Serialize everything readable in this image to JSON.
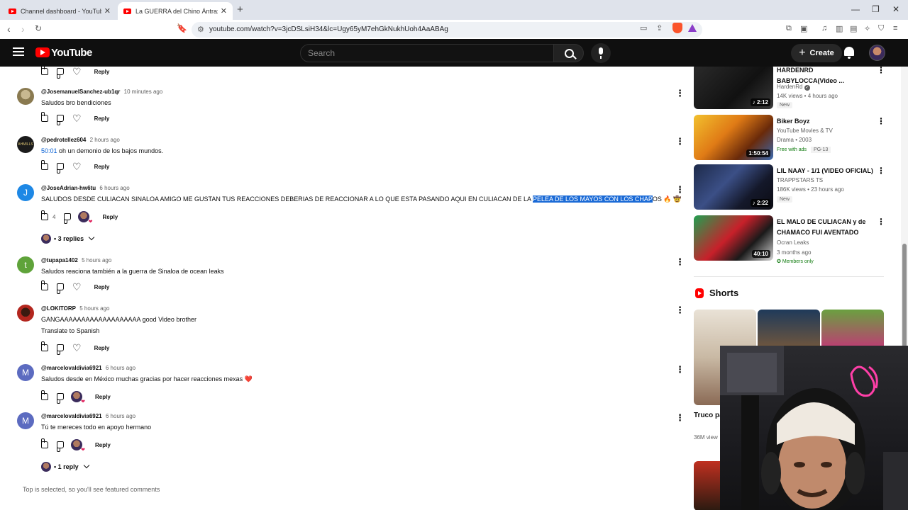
{
  "browser": {
    "tabs": [
      {
        "label": "Channel dashboard - YouTube Studio"
      },
      {
        "label": "La GUERRA del Chino Ántrax vs"
      }
    ],
    "url": "youtube.com/watch?v=3jcDSLsiH34&lc=Ugy65yM7ehGkNukhUoh4AaABAg"
  },
  "masthead": {
    "logo_text": "YouTube",
    "search_placeholder": "Search",
    "create_label": "Create"
  },
  "comments": [
    {
      "handle": "@JosemanuelSanchez-ub1qr",
      "time": "10 minutes ago",
      "text": "Saludos bro bendiciones",
      "reply_label": "Reply",
      "avatar_color": "#a8986a"
    },
    {
      "handle": "@pedrotellez604",
      "time": "2 hours ago",
      "timestamp_link": "50:01",
      "text": "oh un demonio de los bajos mundos.",
      "reply_label": "Reply",
      "avatar_color": "#1b1b1b"
    },
    {
      "handle": "@JoseAdrian-hw6tu",
      "time": "6 hours ago",
      "avatar_letter": "J",
      "avatar_color": "#1e88e5",
      "text_before": "SALUDOS DESDE CULIACAN SINALOA AMIGO ME GUSTAN TUS REACCIONES  DEBERIAS DE REACCIONAR A LO QUE ESTA PASANDO AQUI EN CULIACAN DE LA ",
      "text_highlight": "PELEA DE LOS MAYOS CON LOS CHAP",
      "text_after": "OS 🔥 🤠",
      "likes": "4",
      "reply_label": "Reply",
      "replies_label": "3 replies"
    },
    {
      "handle": "@tupapa1402",
      "time": "5 hours ago",
      "avatar_letter": "t",
      "avatar_color": "#5fa33a",
      "text": "Saludos reaciona también a la guerra de Sinaloa de ocean leaks",
      "reply_label": "Reply"
    },
    {
      "handle": "@LOKITORP",
      "time": "5 hours ago",
      "avatar_color": "#b3261e",
      "text": "GANGAAAAAAAAAAAAAAAAAAA good Video brother",
      "translate": "Translate to Spanish",
      "reply_label": "Reply"
    },
    {
      "handle": "@marcelovaldivia6921",
      "time": "6 hours ago",
      "avatar_letter": "M",
      "avatar_color": "#5c6bc0",
      "text": "Saludos desde en México muchas gracias por hacer reacciones mexas ❤️",
      "reply_label": "Reply"
    },
    {
      "handle": "@marcelovaldivia6921",
      "time": "6 hours ago",
      "avatar_letter": "M",
      "avatar_color": "#5c6bc0",
      "text": "Tú te mereces todo en apoyo hermano",
      "reply_label": "Reply",
      "replies_label": "1 reply"
    }
  ],
  "comments_notice": "Top is selected, so you'll see featured comments",
  "sidebar": {
    "videos": [
      {
        "title": "HARDENRD BABYLOCCA(Video ...",
        "channel": "HardenRd",
        "stats": "14K views • 4 hours ago",
        "badge": "New",
        "duration": "♪ 2:12"
      },
      {
        "title": "Biker Boyz",
        "channel": "YouTube Movies & TV",
        "stats": "Drama • 2003",
        "badge": "Free with ads",
        "badge2": "PG-13",
        "duration": "1:50:54"
      },
      {
        "title": "LIL NAAY - 1/1 (VIDEO OFICIAL)",
        "channel": "TRAPPSTARS TS",
        "stats": "186K views • 23 hours ago",
        "badge": "New",
        "duration": "♪ 2:22"
      },
      {
        "title": "EL MALO DE CULIACAN y de CHAMACO FUI AVENTADO",
        "channel": "Ocran Leaks",
        "stats": "3 months ago",
        "badge": "Members only",
        "duration": "40:10"
      }
    ],
    "shorts_heading": "Shorts",
    "short_title": "Truco pa vender",
    "short_views": "36M view"
  },
  "colors": {
    "accent": "#065fd4",
    "brand": "#ff0000",
    "highlight": "#1a6ad6"
  }
}
